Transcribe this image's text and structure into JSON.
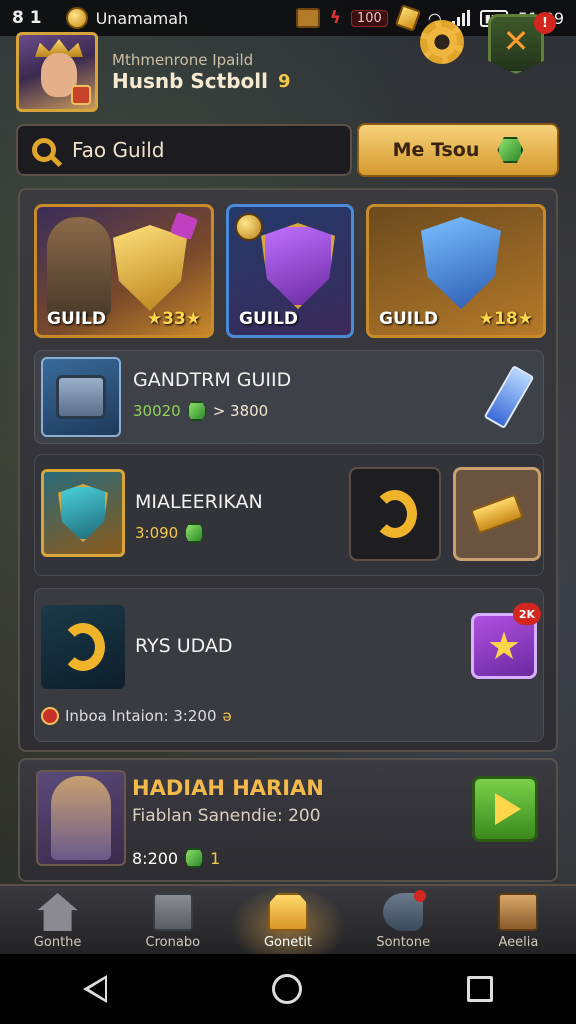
{
  "status_bar": {
    "signal": "8 1",
    "app_name": "Unamamah",
    "stat_value": "100",
    "time": "51:89"
  },
  "profile": {
    "subtitle": "Mthmenrone Ipaild",
    "name": "Husnb Sctboll",
    "level": "9",
    "notification_count": "!"
  },
  "search": {
    "text": "Fao Guild"
  },
  "my_tab": {
    "label": "Me Tsou"
  },
  "guild_tiles": [
    {
      "label": "GUILD",
      "stars": "★33★"
    },
    {
      "label": "GUILD",
      "stars": ""
    },
    {
      "label": "GUILD",
      "stars": "★18★"
    }
  ],
  "rows": {
    "grand_guild": {
      "title": "GANDTRM GUIID",
      "value_a": "30020",
      "value_b": "> 3800"
    },
    "mileerikan": {
      "title": "MIALEERIKAN",
      "value": "3:090"
    },
    "rys_udad": {
      "title": "RYS UDAD",
      "info": "Inboa Intaion: 3:200",
      "badge": "2K"
    }
  },
  "daily_reward": {
    "title": "HADIAH HARIAN",
    "subtitle": "Fiablan Sanendie: 200",
    "value": "8:200",
    "count": "1"
  },
  "bottom_nav": [
    {
      "label": "Gonthe",
      "icon": "home-icon"
    },
    {
      "label": "Cronabo",
      "icon": "box-icon"
    },
    {
      "label": "Gonetit",
      "icon": "guild-icon"
    },
    {
      "label": "Sontone",
      "icon": "cannon-icon"
    },
    {
      "label": "Aeelia",
      "icon": "crate-icon"
    }
  ],
  "colors": {
    "accent_gold": "#e0a52a",
    "accent_green": "#3a8a1e",
    "panel_bg": "#33343a"
  }
}
